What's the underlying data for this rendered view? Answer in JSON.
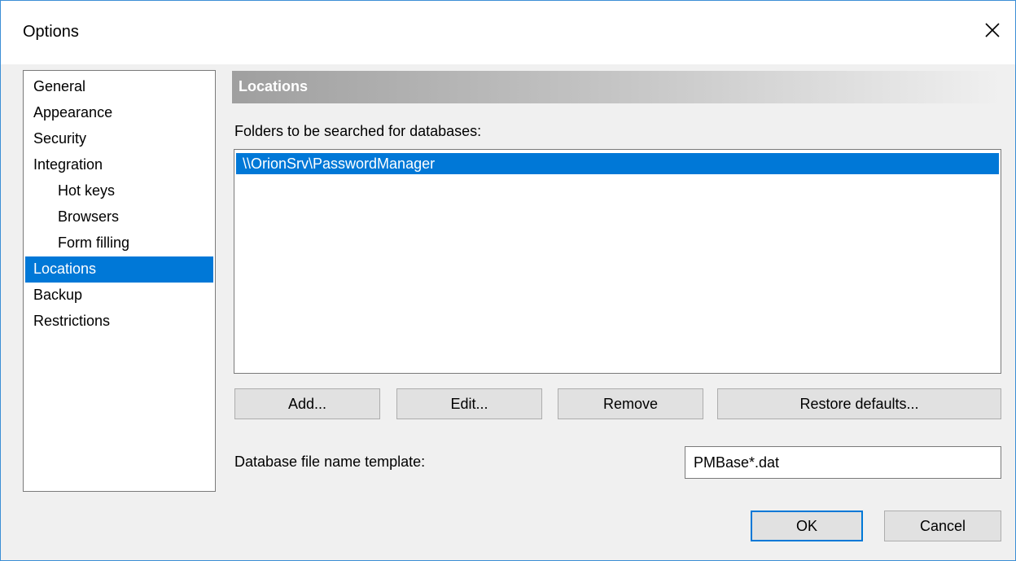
{
  "window": {
    "title": "Options"
  },
  "nav": {
    "items": [
      {
        "label": "General",
        "indent": false,
        "selected": false
      },
      {
        "label": "Appearance",
        "indent": false,
        "selected": false
      },
      {
        "label": "Security",
        "indent": false,
        "selected": false
      },
      {
        "label": "Integration",
        "indent": false,
        "selected": false
      },
      {
        "label": "Hot keys",
        "indent": true,
        "selected": false
      },
      {
        "label": "Browsers",
        "indent": true,
        "selected": false
      },
      {
        "label": "Form filling",
        "indent": true,
        "selected": false
      },
      {
        "label": "Locations",
        "indent": false,
        "selected": true
      },
      {
        "label": "Backup",
        "indent": false,
        "selected": false
      },
      {
        "label": "Restrictions",
        "indent": false,
        "selected": false
      }
    ]
  },
  "main": {
    "section_title": "Locations",
    "folders_label": "Folders to be searched for databases:",
    "folders": [
      "\\\\OrionSrv\\PasswordManager"
    ],
    "buttons": {
      "add": "Add...",
      "edit": "Edit...",
      "remove": "Remove",
      "restore": "Restore defaults..."
    },
    "template_label": "Database file name template:",
    "template_value": "PMBase*.dat"
  },
  "footer": {
    "ok": "OK",
    "cancel": "Cancel"
  },
  "colors": {
    "selection": "#0078d7",
    "accent_border": "#3c8fd6"
  }
}
